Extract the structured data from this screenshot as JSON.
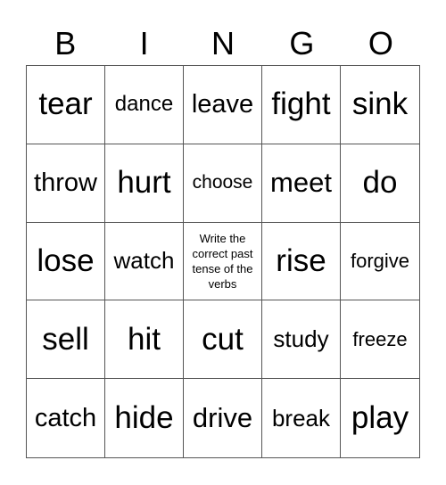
{
  "header": [
    "B",
    "I",
    "N",
    "G",
    "O"
  ],
  "cells": [
    "tear",
    "dance",
    "leave",
    "fight",
    "sink",
    "throw",
    "hurt",
    "choose",
    "meet",
    "do",
    "lose",
    "watch",
    "Write the correct past tense of the verbs",
    "rise",
    "forgive",
    "sell",
    "hit",
    "cut",
    "study",
    "freeze",
    "catch",
    "hide",
    "drive",
    "break",
    "play"
  ]
}
